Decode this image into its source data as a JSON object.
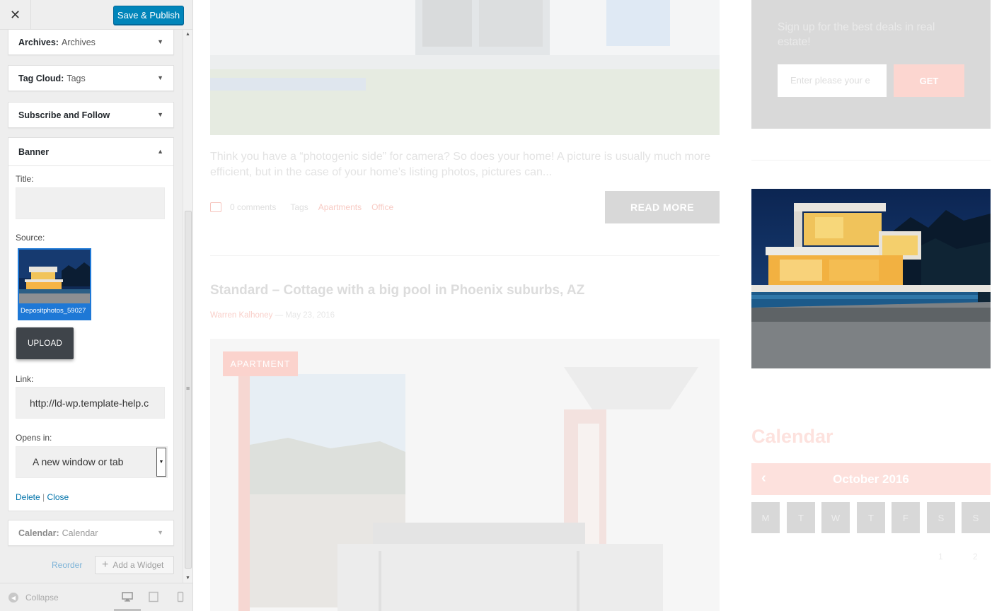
{
  "customizer": {
    "close_icon": "close-icon",
    "publish_label": "Save & Publish",
    "widgets_top": [
      {
        "title": "Archives:",
        "sub": "Archives"
      },
      {
        "title": "Tag Cloud:",
        "sub": "Tags"
      },
      {
        "title": "Subscribe and Follow",
        "sub": ""
      }
    ],
    "banner": {
      "title": "Banner",
      "title_label": "Title:",
      "title_value": "",
      "source_label": "Source:",
      "source_filename": "Depositphotos_59027",
      "upload_label": "UPLOAD",
      "link_label": "Link:",
      "link_value": "http://ld-wp.template-help.c",
      "opens_label": "Opens in:",
      "opens_value": "A new window or tab",
      "delete_label": "Delete",
      "separator": "|",
      "close_label": "Close"
    },
    "widget_bottom": {
      "title": "Calendar:",
      "sub": "Calendar"
    },
    "reorder_label": "Reorder",
    "add_widget_label": "Add a Widget",
    "collapse_label": "Collapse",
    "devices": [
      "desktop-icon",
      "tablet-icon",
      "mobile-icon"
    ]
  },
  "preview": {
    "excerpt": "Think you have a “photogenic side” for camera? So does your home! A picture is usually much more efficient, but in the case of your home’s listing photos, pictures can...",
    "comments": "0 comments",
    "tags_label": "Tags",
    "tag1": "Apartments",
    "tag2": "Office",
    "read_more": "READ MORE",
    "post_title": "Standard – Cottage with a big pool in Phoenix suburbs, AZ",
    "author": "Warren Kalhoney",
    "date_sep": "—",
    "date": "May 23, 2016",
    "badge": "APARTMENT",
    "signup_text": "Sign up for the best deals in real estate!",
    "signup_placeholder": "Enter please your e",
    "signup_button": "GET",
    "calendar_title": "Calendar",
    "calendar_month": "October 2016",
    "calendar_days": [
      "M",
      "T",
      "W",
      "T",
      "F",
      "S",
      "S"
    ],
    "calendar_first_row": [
      "1",
      "2"
    ]
  },
  "colors": {
    "accent": "#0085ba",
    "selection": "#1e78d6",
    "upload_button": "#3f444a",
    "preview_pink": "#fde1dd"
  }
}
